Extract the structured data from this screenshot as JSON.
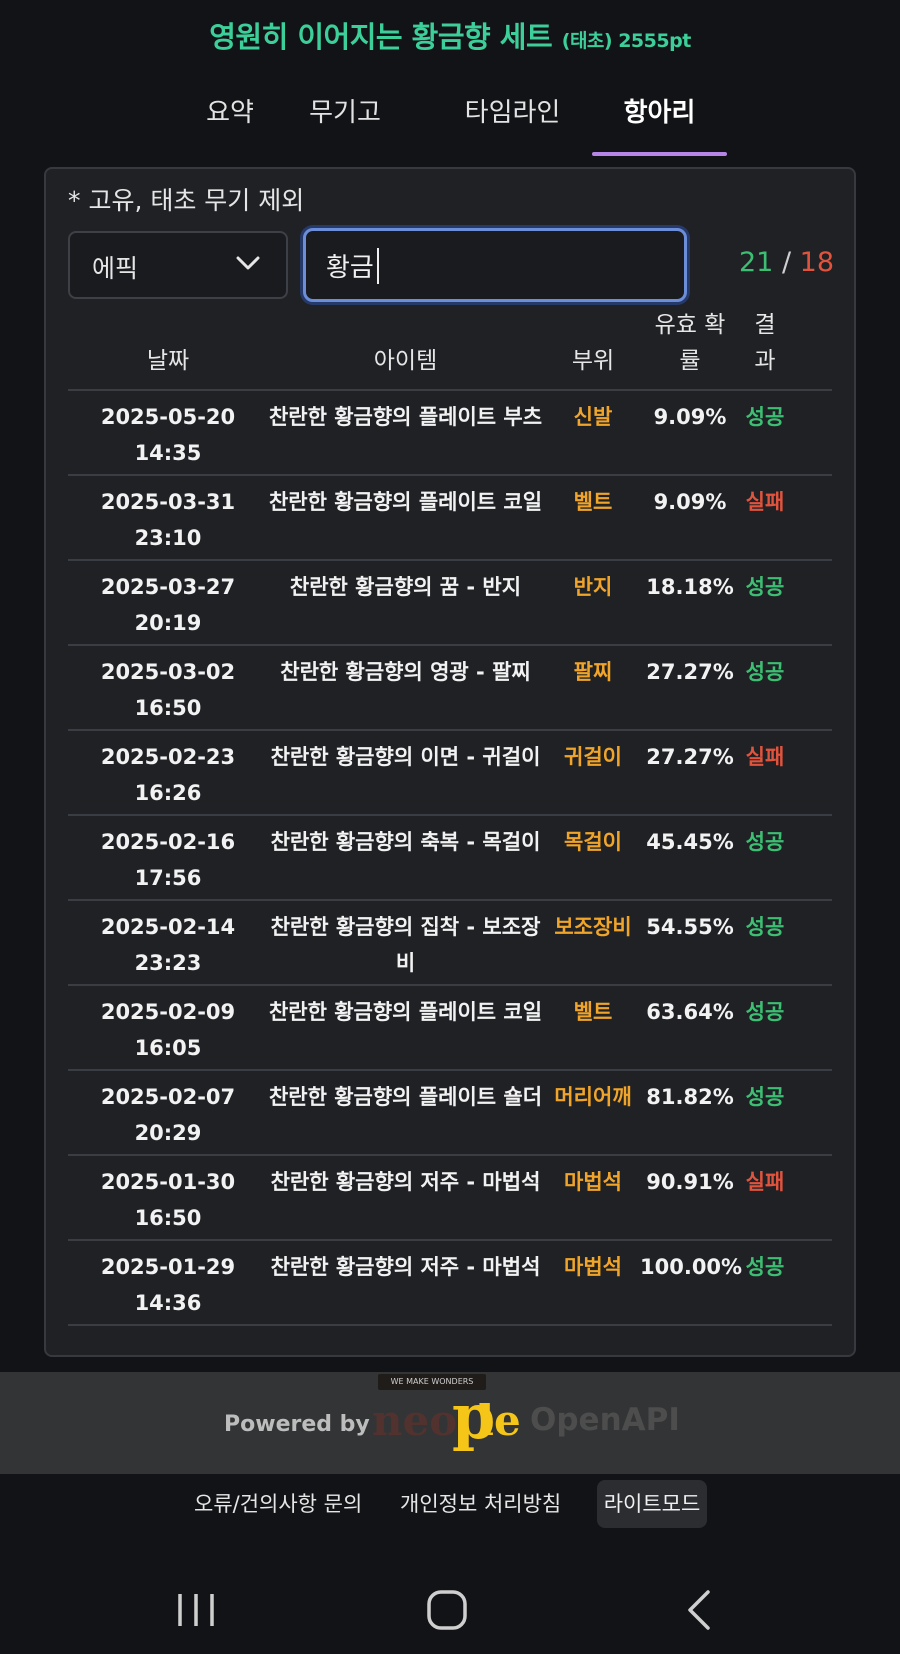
{
  "header": {
    "title": "영원히 이어지는 황금향 세트",
    "subtitle": "(태초) 2555pt"
  },
  "tabs": [
    {
      "label": "요약",
      "active": false
    },
    {
      "label": "무기고",
      "active": false
    },
    {
      "label": "타임라인",
      "active": false
    },
    {
      "label": "항아리",
      "active": true
    }
  ],
  "panel": {
    "note": "* 고유, 태초 무기 제외",
    "filter_select": "에픽",
    "search_value": "황금",
    "count_success": "21",
    "count_sep": "/",
    "count_fail": "18"
  },
  "table": {
    "headers": {
      "date": "날짜",
      "item": "아이템",
      "slot": "부위",
      "prob_line1": "유효 확",
      "prob_line2": "률",
      "result_line1": "결",
      "result_line2": "과"
    },
    "rows": [
      {
        "date": "2025-05-20",
        "time": "14:35",
        "item": "찬란한 황금향의 플레이트 부츠",
        "slot": "신발",
        "prob": "9.09%",
        "result": "성공"
      },
      {
        "date": "2025-03-31",
        "time": "23:10",
        "item": "찬란한 황금향의 플레이트 코일",
        "slot": "벨트",
        "prob": "9.09%",
        "result": "실패"
      },
      {
        "date": "2025-03-27",
        "time": "20:19",
        "item": "찬란한 황금향의 꿈 - 반지",
        "slot": "반지",
        "prob": "18.18%",
        "result": "성공"
      },
      {
        "date": "2025-03-02",
        "time": "16:50",
        "item": "찬란한 황금향의 영광 - 팔찌",
        "slot": "팔찌",
        "prob": "27.27%",
        "result": "성공"
      },
      {
        "date": "2025-02-23",
        "time": "16:26",
        "item": "찬란한 황금향의 이면 - 귀걸이",
        "slot": "귀걸이",
        "prob": "27.27%",
        "result": "실패"
      },
      {
        "date": "2025-02-16",
        "time": "17:56",
        "item": "찬란한 황금향의 축복 - 목걸이",
        "slot": "목걸이",
        "prob": "45.45%",
        "result": "성공"
      },
      {
        "date": "2025-02-14",
        "time": "23:23",
        "item": "찬란한 황금향의 집착 - 보조장비",
        "slot": "보조장비",
        "prob": "54.55%",
        "result": "성공"
      },
      {
        "date": "2025-02-09",
        "time": "16:05",
        "item": "찬란한 황금향의 플레이트 코일",
        "slot": "벨트",
        "prob": "63.64%",
        "result": "성공"
      },
      {
        "date": "2025-02-07",
        "time": "20:29",
        "item": "찬란한 황금향의 플레이트 숄더",
        "slot": "머리어깨",
        "prob": "81.82%",
        "result": "성공"
      },
      {
        "date": "2025-01-30",
        "time": "16:50",
        "item": "찬란한 황금향의 저주 - 마법석",
        "slot": "마법석",
        "prob": "90.91%",
        "result": "실패"
      },
      {
        "date": "2025-01-29",
        "time": "14:36",
        "item": "찬란한 황금향의 저주 - 마법석",
        "slot": "마법석",
        "prob": "100.00%",
        "result": "성공"
      }
    ]
  },
  "footer": {
    "powered_by": "Powered by",
    "logo_badge": "WE MAKE WONDERS",
    "logo_neo": "neo",
    "logo_p": "p",
    "logo_le": "le",
    "logo_api": "OpenAPI",
    "links": [
      "오류/건의사항 문의",
      "개인정보 처리방침"
    ],
    "mode_button": "라이트모드"
  },
  "colors": {
    "title": "#3dcf9a",
    "tab_indicator": "#b785e8",
    "success": "#3dbf73",
    "fail": "#e0533d",
    "slot": "#f0a52a",
    "search_focus": "#6c8ed8"
  }
}
